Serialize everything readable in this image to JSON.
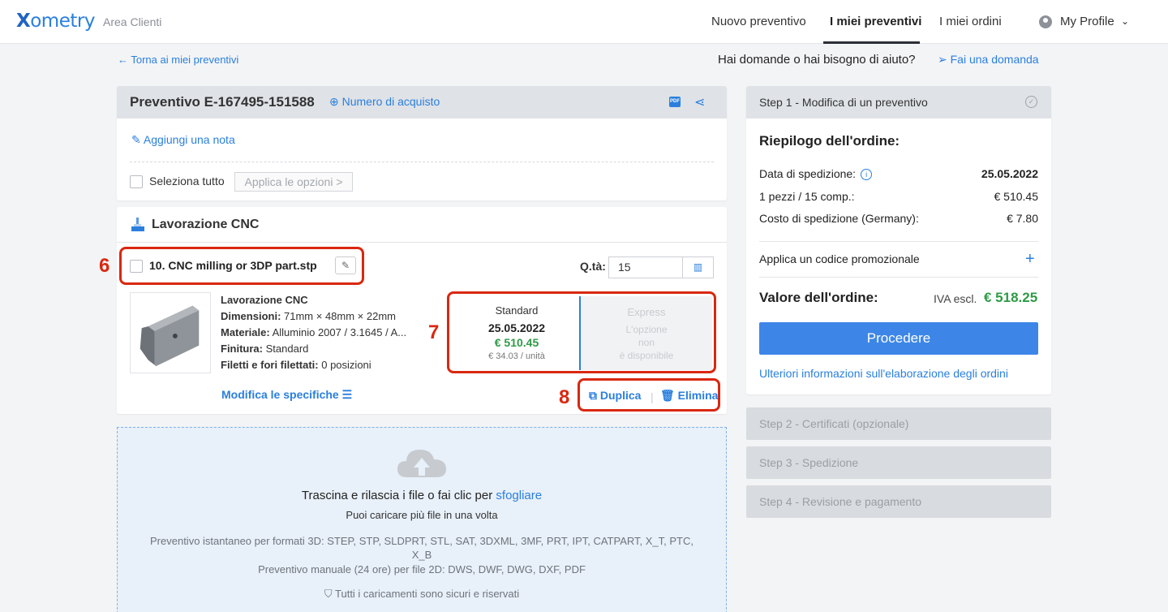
{
  "topbar": {
    "logo_x": "X",
    "logo_rest": "ometry",
    "area": "Area Clienti",
    "nav": [
      "Nuovo preventivo",
      "I miei preventivi",
      "I miei ordini"
    ],
    "profile": "My Profile"
  },
  "subheader": {
    "back": "← Torna ai miei preventivi",
    "help": "Hai domande o hai bisogno di aiuto?",
    "ask": "Fai una domanda"
  },
  "quote": {
    "title": "Preventivo E-167495-151588",
    "po_link": "Numero di acquisto",
    "add_note": "Aggiungi una nota",
    "select_all": "Seleziona tutto",
    "apply_options": "Applica le opzioni >"
  },
  "cnc": {
    "title": "Lavorazione CNC",
    "part_name": "10. CNC milling or 3DP part.stp",
    "qty_label": "Q.tà:",
    "qty_value": "15",
    "specs": {
      "process": "Lavorazione CNC",
      "dim_label": "Dimensioni:",
      "dim_value": " 71mm × 48mm × 22mm",
      "mat_label": "Materiale:",
      "mat_value": " Alluminio 2007 / 3.1645 / A...",
      "fin_label": "Finitura:",
      "fin_value": " Standard",
      "thr_label": "Filetti e fori filettati:",
      "thr_value": " 0 posizioni"
    },
    "modify": "Modifica le specifiche",
    "standard": {
      "name": "Standard",
      "date": "25.05.2022",
      "price": "€ 510.45",
      "unit": "€ 34.03 / unità"
    },
    "express": {
      "name": "Express",
      "l1": "L'opzione",
      "l2": "non",
      "l3": "è disponibile"
    },
    "duplicate": "Duplica",
    "delete": "Elimina"
  },
  "annotations": [
    "6",
    "7",
    "8"
  ],
  "upload": {
    "line1_prefix": "Trascina e rilascia i file o fai clic per ",
    "line1_link": "sfogliare",
    "line2": "Puoi caricare più file in una volta",
    "line3": "Preventivo istantaneo per formati 3D: STEP, STP, SLDPRT, STL, SAT, 3DXML, 3MF, PRT, IPT, CATPART, X_T, PTC, X_B",
    "line4": "Preventivo manuale (24 ore) per file 2D: DWS, DWF, DWG, DXF, PDF",
    "line5": "Tutti i caricamenti sono sicuri e riservati"
  },
  "summary": {
    "step1": "Step 1 - Modifica di un preventivo",
    "title": "Riepilogo dell'ordine:",
    "ship_date_label": "Data di spedizione:",
    "ship_date": "25.05.2022",
    "pieces_label": "1 pezzi / 15 comp.:",
    "pieces_value": "€ 510.45",
    "ship_cost_label": "Costo di spedizione (Germany):",
    "ship_cost": "€ 7.80",
    "promo": "Applica un codice promozionale",
    "total_label": "Valore dell'ordine:",
    "iva": "IVA escl.",
    "total": "€ 518.25",
    "proceed": "Procedere",
    "more_info": "Ulteriori informazioni sull'elaborazione degli ordini",
    "steps": [
      "Step 2 - Certificati (opzionale)",
      "Step 3 - Spedizione",
      "Step 4 - Revisione e pagamento"
    ]
  },
  "colors": {
    "accent": "#2a7fde",
    "price_green": "#2e9a46",
    "annotation_red": "#d9280f"
  }
}
